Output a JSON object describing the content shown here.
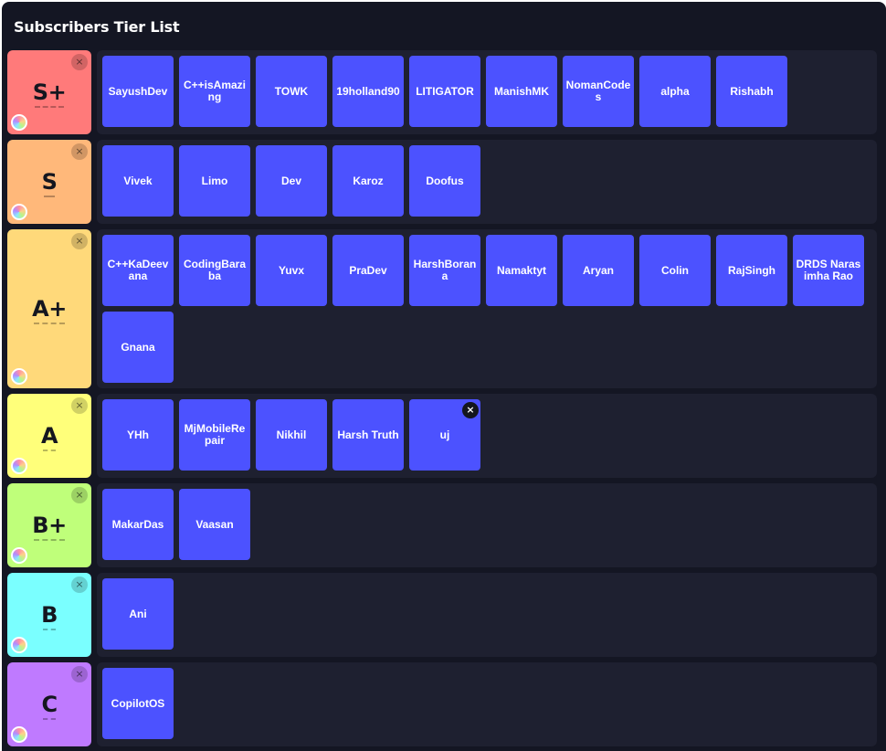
{
  "page": {
    "title": "Subscribers Tier List"
  },
  "icons": {
    "close": "×",
    "color_picker": "color-wheel-icon"
  },
  "tiers": [
    {
      "label": "S+",
      "color": "#ff7a7a",
      "items": [
        "SayushDev",
        "C++isAmazing",
        "TOWK",
        "19holland90",
        "LITIGATOR",
        "ManishMK",
        "NomanCodes",
        "alpha",
        "Rishabh"
      ]
    },
    {
      "label": "S",
      "color": "#ffb87a",
      "items": [
        "Vivek",
        "Limo",
        "Dev",
        "Karoz",
        "Doofus"
      ]
    },
    {
      "label": "A+",
      "color": "#ffd97a",
      "items": [
        "C++KaDeevana",
        "CodingBaraba",
        "Yuvx",
        "PraDev",
        "HarshBorana",
        "Namaktyt",
        "Aryan",
        "Colin",
        "RajSingh",
        "DRDS Narasimha Rao",
        "Gnana"
      ]
    },
    {
      "label": "A",
      "color": "#ffff7a",
      "items": [
        "YHh",
        "MjMobileRepair",
        "Nikhil",
        "Harsh Truth",
        "uj"
      ]
    },
    {
      "label": "B+",
      "color": "#bfff7a",
      "items": [
        "MakarDas",
        "Vaasan"
      ]
    },
    {
      "label": "B",
      "color": "#7affff",
      "items": [
        "Ani"
      ]
    },
    {
      "label": "C",
      "color": "#bf7aff",
      "items": [
        "CopilotOS"
      ]
    }
  ]
}
